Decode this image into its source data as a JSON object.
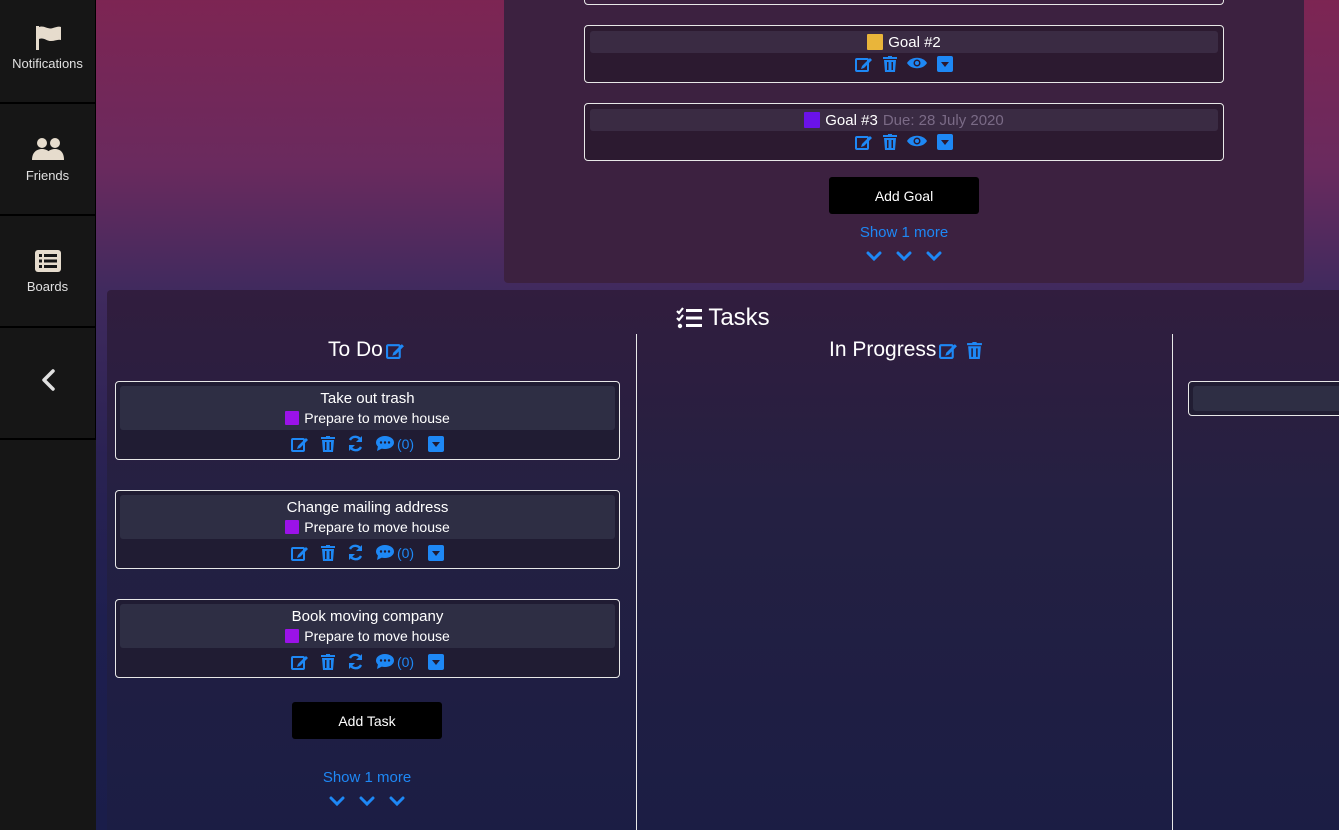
{
  "sidebar": {
    "items": [
      {
        "label": "Notifications",
        "icon": "flag-icon"
      },
      {
        "label": "Friends",
        "icon": "users-icon"
      },
      {
        "label": "Boards",
        "icon": "list-icon"
      },
      {
        "label": "",
        "icon": "chevron-left-icon"
      }
    ]
  },
  "goals": {
    "cards": [
      {
        "title": "Goal #2",
        "color": "#e9b53a",
        "due": ""
      },
      {
        "title": "Goal #3",
        "color": "#6a12e8",
        "due": "Due: 28 July 2020"
      }
    ],
    "add_label": "Add Goal",
    "show_more": "Show 1 more"
  },
  "tasks": {
    "title": "Tasks",
    "columns": [
      {
        "title": "To Do"
      },
      {
        "title": "In Progress"
      }
    ],
    "todo": [
      {
        "title": "Take out trash",
        "goal": "Prepare to move house",
        "goal_color": "#9b12e8",
        "comments": "(0)"
      },
      {
        "title": "Change mailing address",
        "goal": "Prepare to move house",
        "goal_color": "#9b12e8",
        "comments": "(0)"
      },
      {
        "title": "Book moving company",
        "goal": "Prepare to move house",
        "goal_color": "#9b12e8",
        "comments": "(0)"
      }
    ],
    "add_label": "Add Task",
    "show_more": "Show 1 more"
  },
  "colors": {
    "accent": "#1e88f5"
  }
}
